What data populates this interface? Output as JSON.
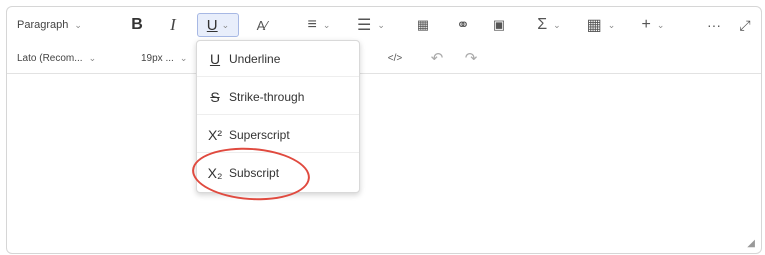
{
  "toolbar": {
    "format_label": "Paragraph",
    "font_label": "Lato (Recom...",
    "size_label": "19px ...",
    "bold_glyph": "B",
    "italic_glyph": "I",
    "underline_glyph": "U",
    "more_glyph": "···"
  },
  "underline_menu": {
    "items": [
      {
        "icon": "U",
        "label": "Underline"
      },
      {
        "icon": "S",
        "label": "Strike-through"
      },
      {
        "icon": "X²",
        "label": "Superscript"
      },
      {
        "icon": "X₂",
        "label": "Subscript"
      }
    ]
  },
  "colors": {
    "highlight_circle": "#e04a3f",
    "active_button_bg": "#e8eefb"
  }
}
